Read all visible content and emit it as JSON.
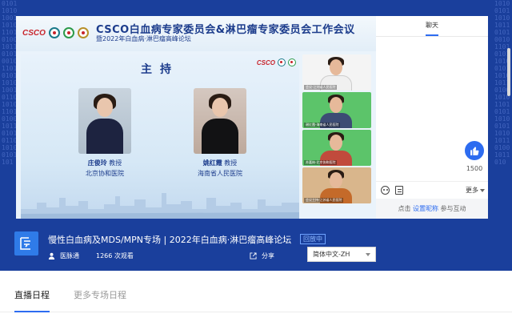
{
  "video": {
    "title": "CSCO白血病专家委员会&淋巴瘤专家委员会工作会议",
    "subtitle": "暨2022年白血病·淋巴瘤高峰论坛",
    "logo_text": "CSCO",
    "slide": {
      "heading": "主持",
      "hosts": [
        {
          "name": "庄俊玲",
          "title": "教授",
          "org": "北京协和医院"
        },
        {
          "name": "姚红霞",
          "title": "教授",
          "org": "海南省人民医院"
        }
      ]
    },
    "cameras": [
      "会议-江刘省人民医院",
      "谢红霞-海南省人民医院",
      "苏嘉纳-北京协和医院",
      "会议主持-江苏省人民医院"
    ]
  },
  "chat": {
    "tab_label": "聊天",
    "like_count": "1500",
    "more_label": "更多",
    "input_prefix": "点击",
    "input_link": "设置昵称",
    "input_suffix": "参与互动"
  },
  "event": {
    "title": "慢性白血病及MDS/MPN专场 | 2022年白血病·淋巴瘤高峰论坛",
    "status_badge": "回放中",
    "org_name": "医脉通",
    "views": "1266 次观看",
    "share_label": "分享",
    "language": "简体中文-ZH"
  },
  "tabs": [
    {
      "label": "直播日程"
    },
    {
      "label": "更多专场日程"
    }
  ],
  "colors": {
    "hero_bg": "#1a3f9c",
    "accent": "#2d6cf0",
    "badge": "#8fb9ff"
  }
}
